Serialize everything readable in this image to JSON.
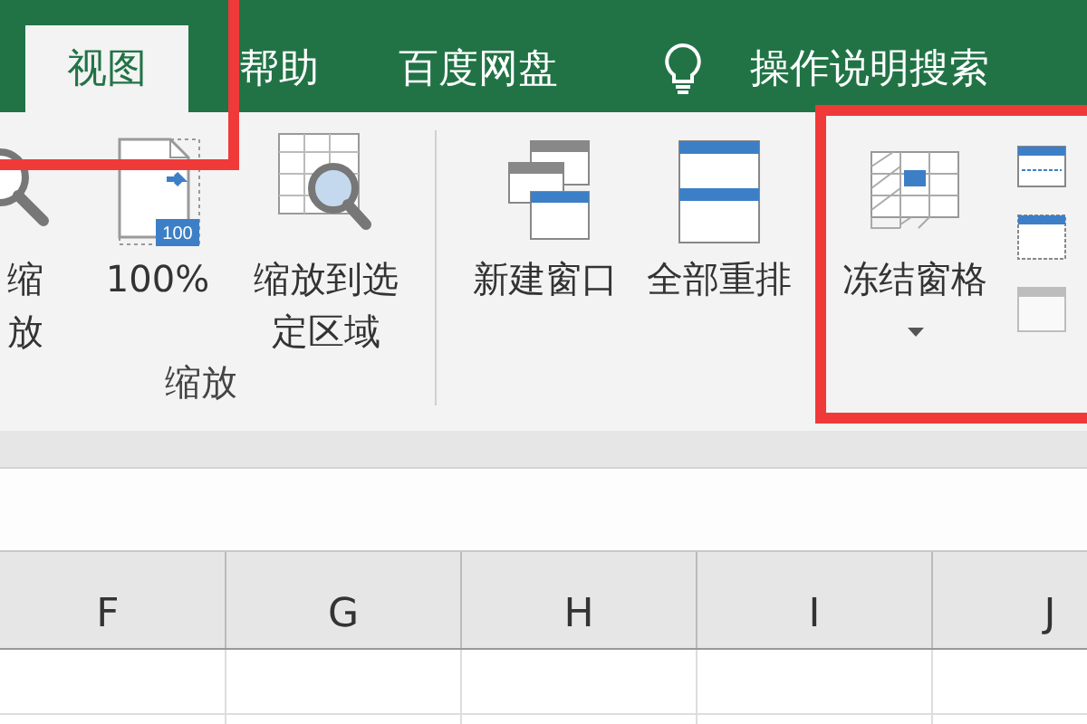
{
  "tabs": [
    {
      "label": "视图",
      "selected": true
    },
    {
      "label": "帮助",
      "selected": false
    },
    {
      "label": "百度网盘",
      "selected": false
    }
  ],
  "search": {
    "placeholder": "操作说明搜索"
  },
  "ribbon": {
    "groups": [
      {
        "label": "缩放",
        "buttons": [
          {
            "kind": "magnifier",
            "label": "缩放",
            "dropdown": false
          },
          {
            "kind": "page100",
            "label": "100%",
            "dropdown": false,
            "icon_text": "100"
          },
          {
            "kind": "zoom-selection",
            "label": "缩放到选定区域",
            "dropdown": false
          }
        ]
      },
      {
        "buttons": [
          {
            "kind": "new-window",
            "label": "新建窗口",
            "dropdown": false
          },
          {
            "kind": "arrange-all",
            "label": "全部重排",
            "dropdown": false
          }
        ]
      },
      {
        "buttons": [
          {
            "kind": "freeze-panes",
            "label": "冻结窗格",
            "dropdown": true
          }
        ],
        "small_buttons": [
          {
            "kind": "split",
            "disabled": false
          },
          {
            "kind": "hide",
            "disabled": false
          },
          {
            "kind": "unhide",
            "disabled": true
          }
        ]
      }
    ]
  },
  "sheet": {
    "columns": [
      "F",
      "G",
      "H",
      "I",
      "J"
    ]
  }
}
